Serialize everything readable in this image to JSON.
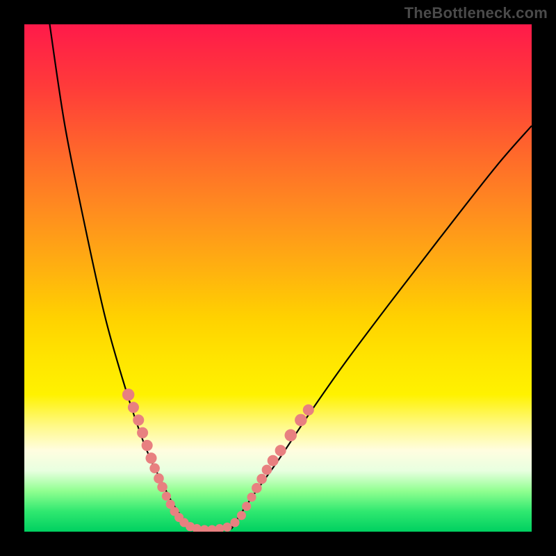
{
  "watermark": "TheBottleneck.com",
  "colors": {
    "frame_bg": "#000000",
    "curve_stroke": "#000000",
    "dot_fill": "#e88080",
    "gradient": [
      "#ff1a4a",
      "#ff3a3a",
      "#ff6a2a",
      "#ff8a20",
      "#ffb010",
      "#ffd200",
      "#ffe500",
      "#fff200",
      "#fff985",
      "#fffde0",
      "#e8ffe0",
      "#90ff90",
      "#30e870",
      "#00d060"
    ]
  },
  "chart_data": {
    "type": "line",
    "title": "",
    "xlabel": "",
    "ylabel": "",
    "xlim": [
      0,
      100
    ],
    "ylim": [
      0,
      100
    ],
    "grid": false,
    "legend": false,
    "note": "Axes are unlabeled; values inferred by pixel position as percentages of plot area (y increases upward).",
    "series": [
      {
        "name": "left-curve",
        "x": [
          5,
          8,
          12,
          16,
          20,
          23,
          25,
          27,
          29,
          31,
          33
        ],
        "y": [
          100,
          80,
          60,
          42,
          28,
          19,
          14,
          10,
          6,
          3,
          1
        ]
      },
      {
        "name": "valley-floor",
        "x": [
          33,
          36,
          39,
          41
        ],
        "y": [
          1,
          0.5,
          0.5,
          1
        ]
      },
      {
        "name": "right-curve",
        "x": [
          41,
          45,
          50,
          56,
          63,
          72,
          82,
          93,
          100
        ],
        "y": [
          1,
          7,
          14,
          23,
          33,
          45,
          58,
          72,
          80
        ]
      }
    ],
    "scatter_overlay": {
      "name": "pink-dots",
      "points": [
        {
          "x": 20.5,
          "y": 27,
          "r": 1.2
        },
        {
          "x": 21.5,
          "y": 24.5,
          "r": 1.1
        },
        {
          "x": 22.5,
          "y": 22,
          "r": 1.1
        },
        {
          "x": 23.3,
          "y": 19.5,
          "r": 1.1
        },
        {
          "x": 24.2,
          "y": 17,
          "r": 1.1
        },
        {
          "x": 25.0,
          "y": 14.5,
          "r": 1.1
        },
        {
          "x": 25.7,
          "y": 12.5,
          "r": 1.0
        },
        {
          "x": 26.5,
          "y": 10.5,
          "r": 1.0
        },
        {
          "x": 27.2,
          "y": 8.8,
          "r": 1.0
        },
        {
          "x": 28.0,
          "y": 7.0,
          "r": 0.9
        },
        {
          "x": 28.8,
          "y": 5.4,
          "r": 0.9
        },
        {
          "x": 29.6,
          "y": 4.0,
          "r": 0.9
        },
        {
          "x": 30.5,
          "y": 2.8,
          "r": 0.9
        },
        {
          "x": 31.5,
          "y": 1.8,
          "r": 0.9
        },
        {
          "x": 32.7,
          "y": 1.0,
          "r": 0.9
        },
        {
          "x": 34.0,
          "y": 0.6,
          "r": 0.9
        },
        {
          "x": 35.5,
          "y": 0.4,
          "r": 0.9
        },
        {
          "x": 37.0,
          "y": 0.4,
          "r": 0.9
        },
        {
          "x": 38.5,
          "y": 0.6,
          "r": 0.9
        },
        {
          "x": 40.0,
          "y": 0.9,
          "r": 0.9
        },
        {
          "x": 41.5,
          "y": 1.8,
          "r": 0.9
        },
        {
          "x": 42.8,
          "y": 3.2,
          "r": 0.9
        },
        {
          "x": 43.8,
          "y": 5.0,
          "r": 0.9
        },
        {
          "x": 44.8,
          "y": 6.8,
          "r": 0.9
        },
        {
          "x": 45.8,
          "y": 8.6,
          "r": 1.0
        },
        {
          "x": 46.8,
          "y": 10.4,
          "r": 1.0
        },
        {
          "x": 47.8,
          "y": 12.2,
          "r": 1.0
        },
        {
          "x": 49.0,
          "y": 14.0,
          "r": 1.1
        },
        {
          "x": 50.5,
          "y": 16.0,
          "r": 1.1
        },
        {
          "x": 52.5,
          "y": 19.0,
          "r": 1.2
        },
        {
          "x": 54.5,
          "y": 22.0,
          "r": 1.2
        },
        {
          "x": 56.0,
          "y": 24.0,
          "r": 1.1
        }
      ]
    }
  }
}
